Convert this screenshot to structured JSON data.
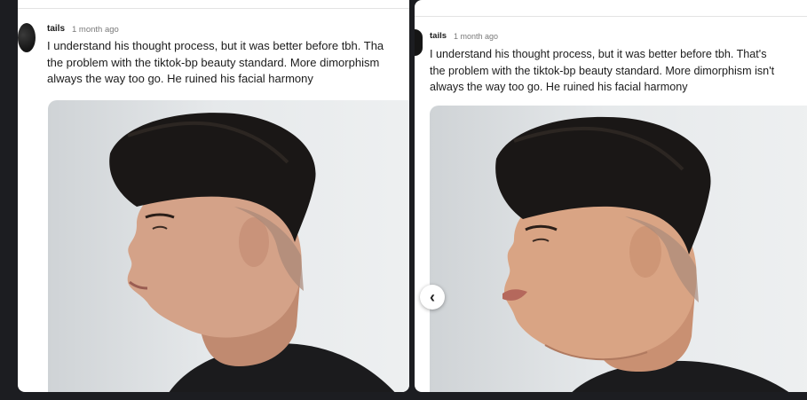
{
  "left_post": {
    "username": "tails",
    "timestamp": "1 month ago",
    "comment_lines": [
      "I understand his thought process, but it was better before tbh. Tha",
      "the problem with the tiktok-bp beauty standard. More dimorphism",
      "always the way too go. He ruined his facial harmony"
    ],
    "photo_icon": "photo-man-side-profile"
  },
  "right_post": {
    "username": "tails",
    "timestamp": "1 month ago",
    "comment_lines": [
      "I understand his thought process, but it was better before tbh. That's",
      "the problem with the tiktok-bp beauty standard. More dimorphism isn't",
      "always the way too go. He ruined his facial harmony"
    ],
    "photo_icon": "photo-man-side-profile-edited"
  },
  "nav": {
    "back_icon": "chevron-left-icon",
    "back_glyph": "‹"
  },
  "colors": {
    "background": "#1c1d21",
    "panel": "#ffffff",
    "text": "#1c1c1c",
    "muted": "#7a7a7a"
  }
}
